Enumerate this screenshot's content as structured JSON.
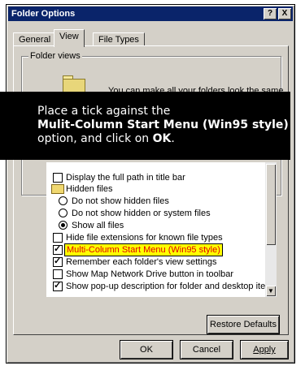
{
  "window": {
    "title": "Folder Options",
    "help_button": "?",
    "close_button": "X"
  },
  "tabs": [
    {
      "label": "General"
    },
    {
      "label": "View"
    },
    {
      "label": "File Types"
    }
  ],
  "folder_views": {
    "group_label": "Folder views",
    "description": "You can make all your folders look the same."
  },
  "callout": {
    "line1": "Place a tick against the",
    "line2": "Mulit-Column Start Menu (Win95 style)",
    "line3_prefix": "option, and click on",
    "line3_ok": "OK",
    "line3_suffix": "."
  },
  "advanced_settings": {
    "items": [
      {
        "label": "Display the full path in title bar",
        "checked": false
      },
      {
        "label": "Hidden files"
      },
      {
        "label": "Do not show hidden files",
        "selected": false
      },
      {
        "label": "Do not show hidden or system files",
        "selected": false
      },
      {
        "label": "Show all files",
        "selected": true
      },
      {
        "label": "Hide file extensions for known file types",
        "checked": false
      },
      {
        "label": "Multi-Column Start Menu (Win95 style)",
        "checked": true
      },
      {
        "label": "Remember each folder's view settings",
        "checked": true
      },
      {
        "label": "Show Map Network Drive button in toolbar",
        "checked": false
      },
      {
        "label": "Show pop-up description for folder and desktop items.",
        "checked": true
      }
    ]
  },
  "buttons": {
    "restore_defaults": "Restore Defaults",
    "ok": "OK",
    "cancel": "Cancel",
    "apply": "Apply"
  }
}
